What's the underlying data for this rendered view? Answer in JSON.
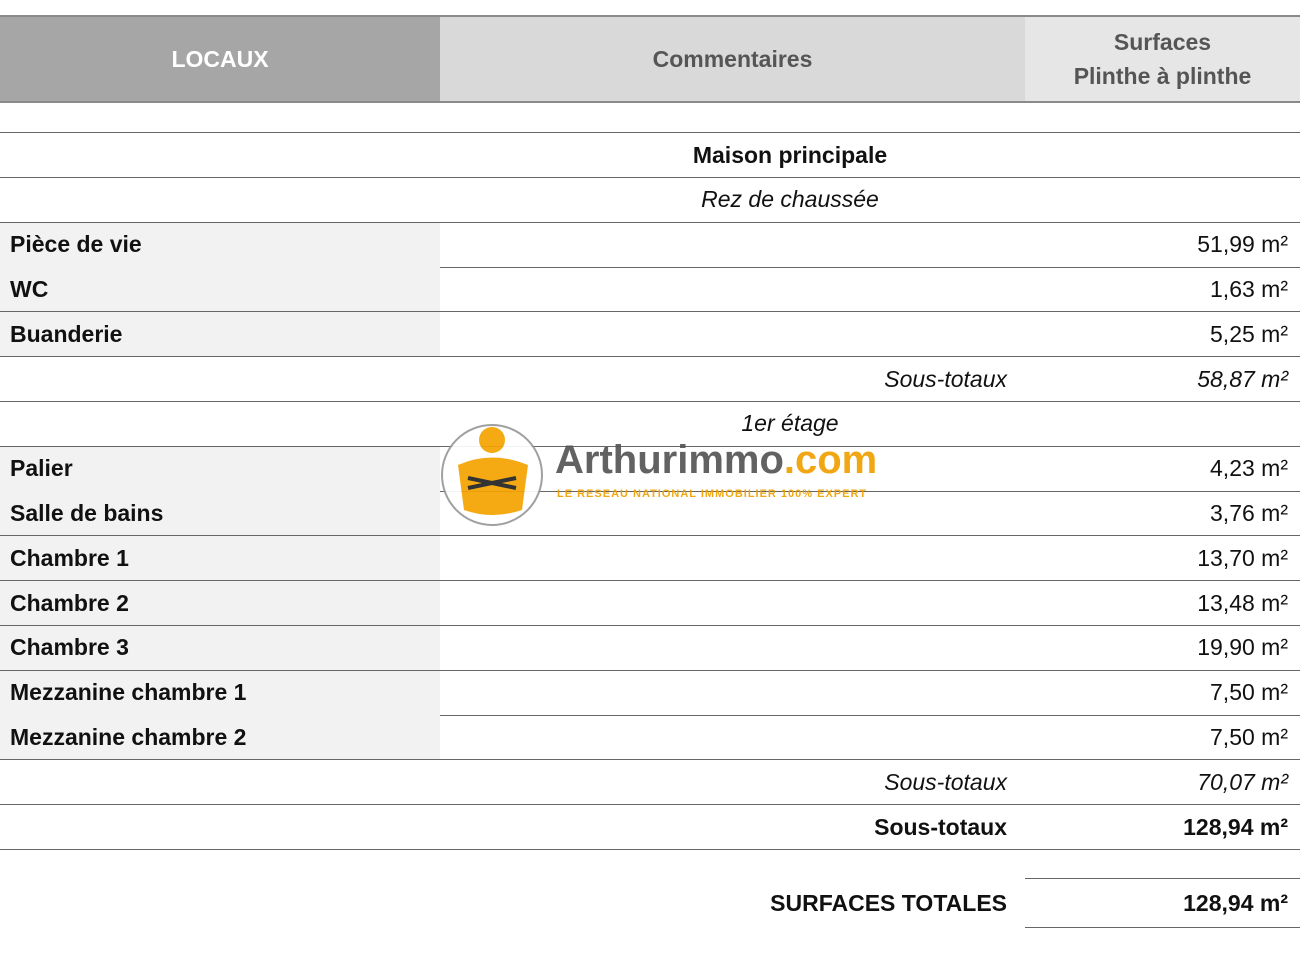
{
  "header": {
    "col1": "LOCAUX",
    "col2": "Commentaires",
    "col3_line1": "Surfaces",
    "col3_line2": "Plinthe à plinthe"
  },
  "building": "Maison principale",
  "levels": [
    {
      "name": "Rez de chaussée",
      "rooms": [
        {
          "name": "Pièce de vie",
          "surface": "51,99 m²"
        },
        {
          "name": "WC",
          "surface": "1,63 m²"
        },
        {
          "name": "Buanderie",
          "surface": "5,25 m²"
        }
      ],
      "subtotal_label": "Sous-totaux",
      "subtotal": "58,87 m²"
    },
    {
      "name": "1er étage",
      "rooms": [
        {
          "name": "Palier",
          "surface": "4,23 m²"
        },
        {
          "name": "Salle de bains",
          "surface": "3,76 m²"
        },
        {
          "name": "Chambre 1",
          "surface": "13,70 m²"
        },
        {
          "name": "Chambre 2",
          "surface": "13,48 m²"
        },
        {
          "name": "Chambre 3",
          "surface": "19,90 m²"
        },
        {
          "name": "Mezzanine chambre 1",
          "surface": "7,50 m²"
        },
        {
          "name": "Mezzanine chambre 2",
          "surface": "7,50 m²"
        }
      ],
      "subtotal_label": "Sous-totaux",
      "subtotal": "70,07 m²"
    }
  ],
  "building_subtotal_label": "Sous-totaux",
  "building_subtotal": "128,94 m²",
  "total_label": "SURFACES TOTALES",
  "total": "128,94 m²",
  "watermark": {
    "brand": "Arthurimmo",
    "brand_suffix": ".com",
    "tagline": "LE RESEAU NATIONAL IMMOBILIER 100% EXPERT"
  }
}
